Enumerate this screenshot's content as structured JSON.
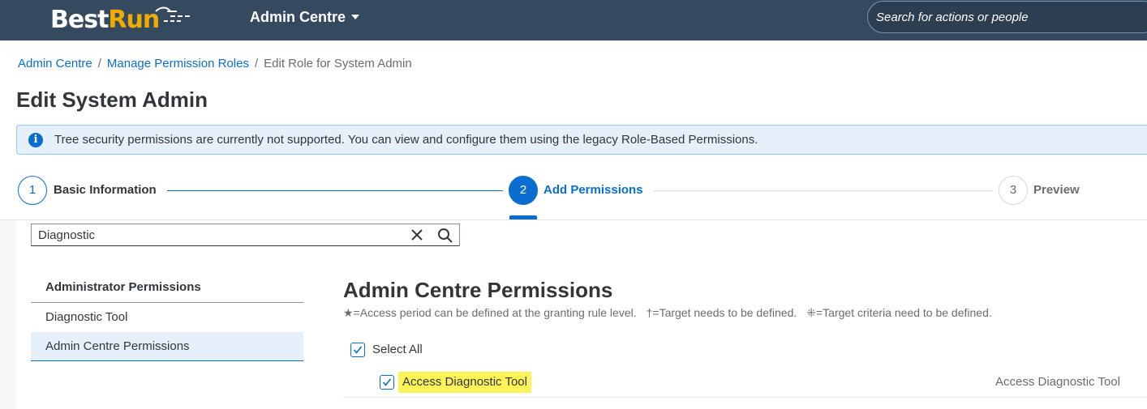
{
  "header": {
    "logo_part1": "Best",
    "logo_part2": "Run",
    "app_title": "Admin Centre",
    "search_placeholder": "Search for actions or people",
    "brand_color": "#f0ab00",
    "shell_color": "#354a5f"
  },
  "breadcrumb": {
    "items": [
      "Admin Centre",
      "Manage Permission Roles"
    ],
    "separator": "/",
    "current": "Edit Role for System Admin"
  },
  "page": {
    "title": "Edit System Admin"
  },
  "info_strip": {
    "icon": "info-icon",
    "text": "Tree security permissions are currently not supported. You can view and configure them using the legacy Role-Based Permissions."
  },
  "wizard": {
    "steps": [
      {
        "number": "1",
        "label": "Basic Information",
        "state": "completed"
      },
      {
        "number": "2",
        "label": "Add Permissions",
        "state": "current"
      },
      {
        "number": "3",
        "label": "Preview",
        "state": "upcoming"
      }
    ],
    "accent_color": "#0a6ed1"
  },
  "filter": {
    "value": "Diagnostic"
  },
  "nav": {
    "heading": "Administrator Permissions",
    "items": [
      {
        "label": "Diagnostic Tool",
        "selected": false
      },
      {
        "label": "Admin Centre Permissions",
        "selected": true
      }
    ]
  },
  "permissions": {
    "title": "Admin Centre Permissions",
    "legend": [
      "★=Access period can be defined at the granting rule level.",
      "†=Target needs to be defined.",
      "⁜=Target criteria need to be defined."
    ],
    "select_all": {
      "label": "Select All",
      "checked": true
    },
    "items": [
      {
        "label": "Access Diagnostic Tool",
        "description": "Access Diagnostic Tool",
        "checked": true,
        "highlight_color": "#fff35a"
      }
    ]
  }
}
